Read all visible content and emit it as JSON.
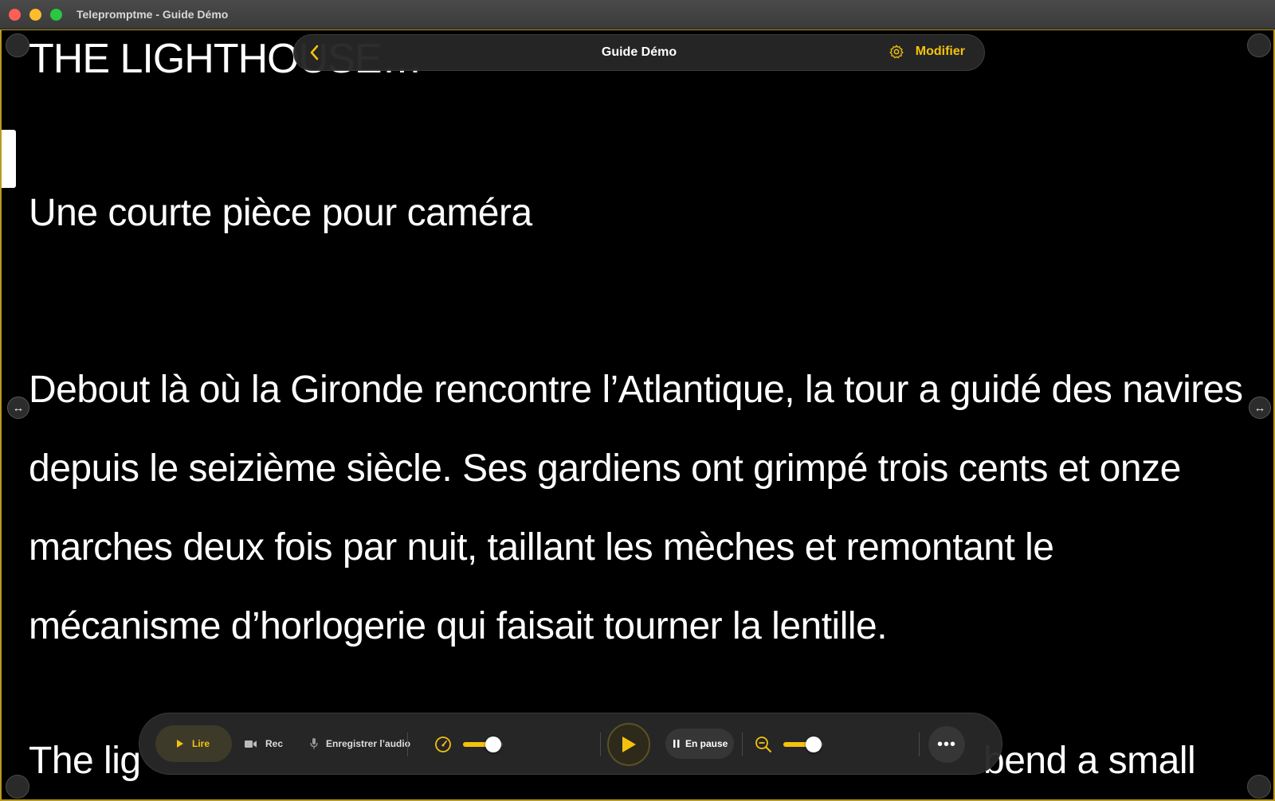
{
  "window": {
    "title": "Telepromptme - Guide Démo"
  },
  "topbar": {
    "back_icon": "chevron-left-icon",
    "title": "Guide Démo",
    "modify_label": "Modifier",
    "settings_icon": "gear-icon"
  },
  "script": {
    "title": "THE LIGHTHOUSE…",
    "subtitle": "Une courte pièce pour caméra",
    "paragraph": "Debout là où la Gironde rencontre l’Atlantique, la tour a guidé des navires depuis le seizième siècle. Ses gardiens ont grimpé trois cents et onze marches deux fois par nuit, taillant les mèches et remontant le mécanisme d’horlogerie qui faisait tourner la lentille.",
    "next_line_start": "The lig",
    "next_line_end": "bend a small"
  },
  "controls": {
    "play_label": "Lire",
    "rec_label": "Rec",
    "audio_label": "Enregistrer l’audio",
    "status_label": "En pause",
    "speed_level": 0.75,
    "zoom_level": 0.75
  },
  "colors": {
    "accent": "#f4c20d",
    "background": "#000000",
    "frame": "#b89a1e"
  }
}
